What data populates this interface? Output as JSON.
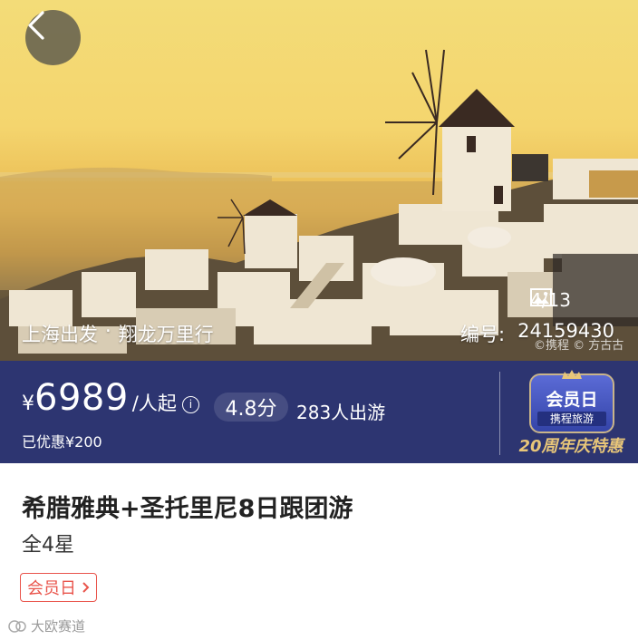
{
  "hero": {
    "photo_count": "4/13",
    "departure_city": "上海出发",
    "agency": "翔龙万里行",
    "product_no_label": "编号:",
    "product_no": "24159430",
    "photo_credit": "©携程 © 方古古"
  },
  "price": {
    "currency": "¥",
    "amount": "6989",
    "unit": "/人起",
    "score": "4.8分",
    "travellers": "283人出游",
    "discount": "已优惠¥200"
  },
  "promo": {
    "title": "会员日",
    "subtitle": "携程旅游",
    "anniversary": "20周年庆特惠"
  },
  "product": {
    "title": "希腊雅典+圣托里尼8日跟团游",
    "hotel_level": "全4星",
    "tag": "会员日"
  },
  "watermark": "大欧赛道",
  "colors": {
    "price_bar": "#2d3571",
    "tag_red": "#e9544b",
    "promo_gold": "#e8c679"
  }
}
